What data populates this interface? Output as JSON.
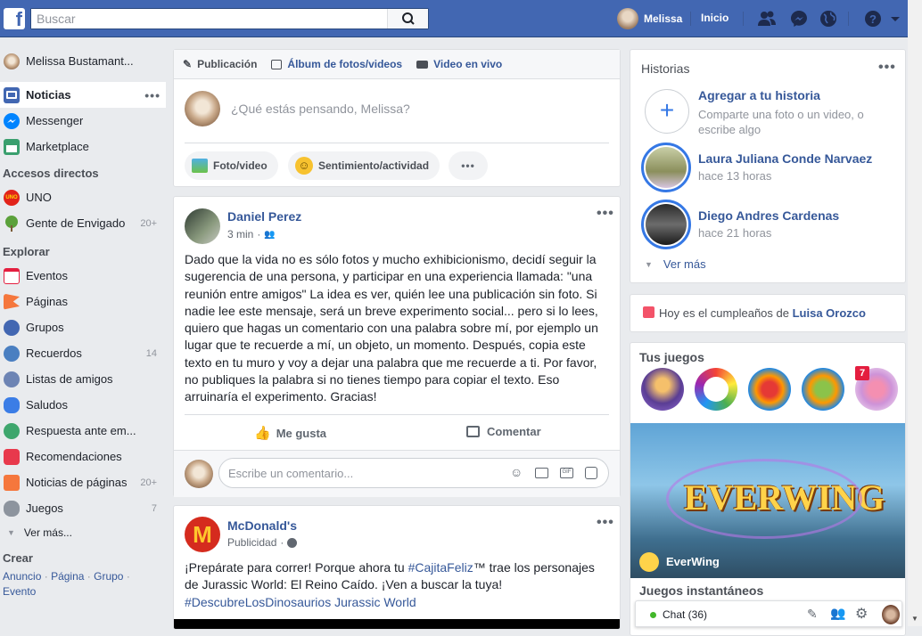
{
  "topbar": {
    "search_placeholder": "Buscar",
    "user_name": "Melissa",
    "home_label": "Inicio",
    "icons": [
      "facebook-logo-icon",
      "search-icon",
      "friend-requests-icon",
      "messenger-icon",
      "notifications-globe-icon",
      "help-icon",
      "dropdown-arrow-icon"
    ]
  },
  "left_nav": {
    "profile_name": "Melissa Bustamant...",
    "items": [
      {
        "label": "Noticias",
        "icon": "news-feed-icon",
        "active": true
      },
      {
        "label": "Messenger",
        "icon": "messenger-icon"
      },
      {
        "label": "Marketplace",
        "icon": "marketplace-icon"
      }
    ],
    "shortcuts_title": "Accesos directos",
    "shortcuts": [
      {
        "label": "UNO",
        "icon": "uno-icon",
        "count": ""
      },
      {
        "label": "Gente de Envigado",
        "icon": "tree-icon",
        "count": "20+"
      }
    ],
    "explore_title": "Explorar",
    "explore": [
      {
        "label": "Eventos",
        "icon": "calendar-icon",
        "count": ""
      },
      {
        "label": "Páginas",
        "icon": "flag-icon",
        "count": ""
      },
      {
        "label": "Grupos",
        "icon": "groups-icon",
        "count": ""
      },
      {
        "label": "Recuerdos",
        "icon": "memories-clock-icon",
        "count": "14"
      },
      {
        "label": "Listas de amigos",
        "icon": "friend-list-icon",
        "count": ""
      },
      {
        "label": "Saludos",
        "icon": "wave-hand-icon",
        "count": ""
      },
      {
        "label": "Respuesta ante em...",
        "icon": "crisis-response-icon",
        "count": ""
      },
      {
        "label": "Recomendaciones",
        "icon": "recommendations-icon",
        "count": ""
      },
      {
        "label": "Noticias de páginas",
        "icon": "pages-feed-icon",
        "count": "20+"
      },
      {
        "label": "Juegos",
        "icon": "gamepad-icon",
        "count": "7"
      }
    ],
    "see_more": "Ver más...",
    "create_title": "Crear",
    "create_links": [
      "Anuncio",
      "Página",
      "Grupo",
      "Evento"
    ],
    "create_sep": "·"
  },
  "composer": {
    "tabs": [
      "Publicación",
      "Álbum de fotos/videos",
      "Video en vivo"
    ],
    "placeholder": "¿Qué estás pensando, Melissa?",
    "photo_label": "Foto/video",
    "feeling_label": "Sentimiento/actividad"
  },
  "post1": {
    "author": "Daniel Perez",
    "time": "3 min",
    "sep": "·",
    "text": "Dado que la vida no es sólo fotos y mucho exhibicionismo, decidí seguir la sugerencia de una persona, y participar en una experiencia llamada: \"una reunión entre amigos\" La idea es ver, quién lee una publicación sin foto. Si nadie lee este mensaje, será un breve experimento social... pero si lo lees, quiero que hagas un comentario con una palabra sobre mí, por ejemplo un lugar que te recuerde a mí, un objeto, un momento. Después, copia este texto en tu muro y voy a dejar una palabra que me recuerde a ti. Por favor, no publiques la palabra si no tienes tiempo para copiar el texto. Eso arruinaría el experimento. Gracias!",
    "like_label": "Me gusta",
    "comment_label": "Comentar",
    "comment_placeholder": "Escribe un comentario..."
  },
  "post2": {
    "author": "McDonald's",
    "meta": "Publicidad",
    "sep": "·",
    "text_prefix": "¡Prepárate para correr! Porque ahora tu ",
    "hashtag1": "#CajitaFeliz",
    "text_middle": "™ trae los personajes de Jurassic World: El Reino Caído. ¡Ven a buscar la tuya! ",
    "hashtag2": "#DescubreLosDinosaurios",
    "text_suffix": " Jurassic World"
  },
  "stories": {
    "title": "Historias",
    "add_title": "Agregar a tu historia",
    "add_sub": "Comparte una foto o un video, o escribe algo",
    "items": [
      {
        "name": "Laura Juliana Conde Narvaez",
        "time": "hace 13 horas"
      },
      {
        "name": "Diego Andres Cardenas",
        "time": "hace 21 horas"
      }
    ],
    "see_more": "Ver más"
  },
  "birthday": {
    "prefix": "Hoy es el cumpleaños de ",
    "name": "Luisa Orozco"
  },
  "games": {
    "title": "Tus juegos",
    "badge": "7",
    "featured": "EverWing",
    "banner_text": "EVERWING",
    "instant_title": "Juegos instantáneos"
  },
  "chat": {
    "label": "Chat (36)"
  },
  "colors": {
    "fb_blue": "#4267b2",
    "link": "#365899",
    "background": "#e9ebee",
    "online": "#42b72a"
  }
}
